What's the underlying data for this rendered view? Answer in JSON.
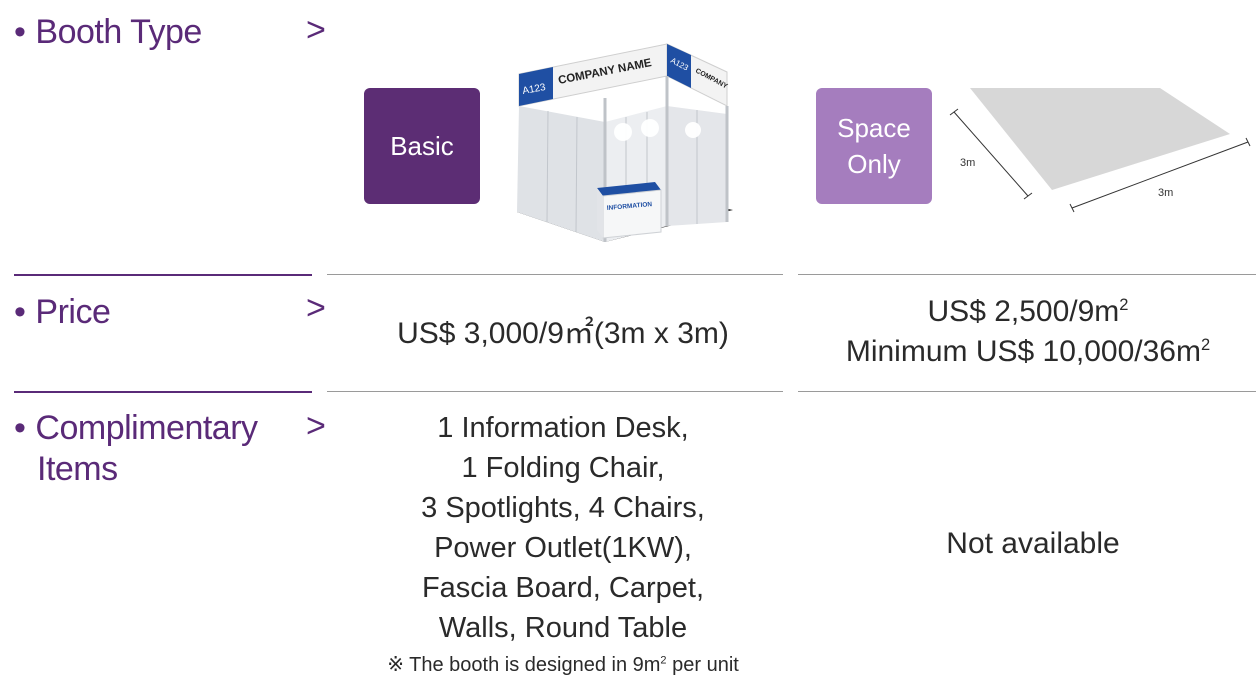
{
  "rows": {
    "booth_type": {
      "label": "Booth Type"
    },
    "price": {
      "label": "Price"
    },
    "complimentary": {
      "label_line1": "Complimentary",
      "label_line2": "Items"
    }
  },
  "bullet": "•",
  "chevron": ">",
  "booths": {
    "basic": {
      "tag": "Basic",
      "fascia_code": "A123",
      "fascia_name": "COMPANY NAME",
      "desk_label": "INFORMATION",
      "price": "US$ 3,000/9㎡(3m x 3m)",
      "items": [
        "1 Information Desk,",
        "1 Folding Chair,",
        "3 Spotlights, 4 Chairs,",
        "Power Outlet(1KW),",
        "Fascia Board, Carpet,",
        "Walls, Round Table"
      ],
      "note_prefix": "※ The booth is designed in 9m",
      "note_sup": "2",
      "note_suffix": " per unit"
    },
    "space_only": {
      "tag_line1": "Space",
      "tag_line2": "Only",
      "dim_side": "3m",
      "dim_bottom": "3m",
      "price_line1": "US$ 2,500/9m",
      "price_line1_sup": "2",
      "price_line2": "Minimum US$ 10,000/36m",
      "price_line2_sup": "2",
      "items": "Not available"
    }
  },
  "colors": {
    "purple_text": "#5a2a78",
    "basic_tag": "#5c2d74",
    "space_tag": "#a57dbe",
    "fascia_blue": "#1f4fa3"
  }
}
